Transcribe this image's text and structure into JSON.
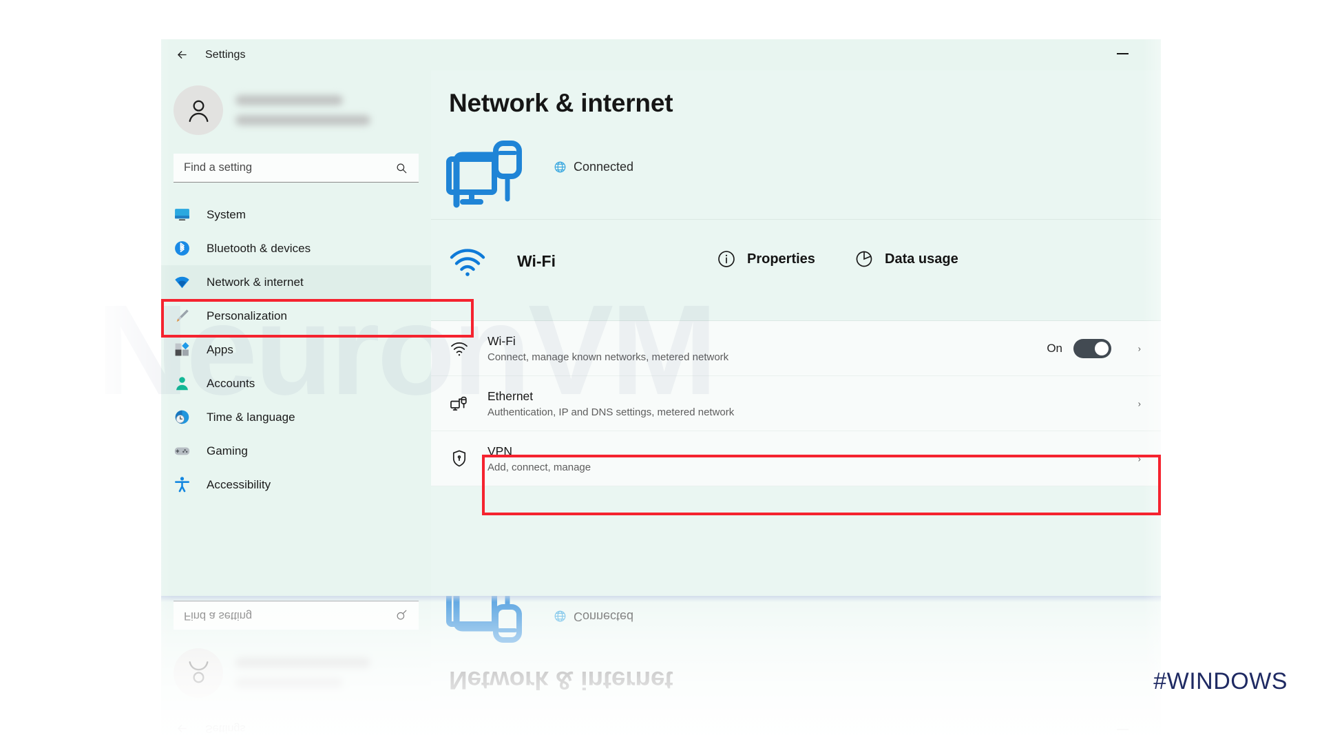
{
  "window": {
    "title": "Settings",
    "back_icon": "back-arrow-icon",
    "minimize_label": "Minimize"
  },
  "sidebar": {
    "account": {
      "avatar_icon": "person-avatar-icon",
      "name_redacted": "",
      "email_redacted": ""
    },
    "search": {
      "placeholder": "Find a setting",
      "icon": "search-icon"
    },
    "items": [
      {
        "label": "System",
        "icon": "monitor-icon",
        "active": false
      },
      {
        "label": "Bluetooth & devices",
        "icon": "bluetooth-icon",
        "active": false
      },
      {
        "label": "Network & internet",
        "icon": "wifi-icon",
        "active": true
      },
      {
        "label": "Personalization",
        "icon": "paintbrush-icon",
        "active": false
      },
      {
        "label": "Apps",
        "icon": "apps-grid-icon",
        "active": false
      },
      {
        "label": "Accounts",
        "icon": "person-icon",
        "active": false
      },
      {
        "label": "Time & language",
        "icon": "clock-globe-icon",
        "active": false
      },
      {
        "label": "Gaming",
        "icon": "gamepad-icon",
        "active": false
      },
      {
        "label": "Accessibility",
        "icon": "accessibility-icon",
        "active": false
      }
    ]
  },
  "content": {
    "page_title": "Network & internet",
    "hero": {
      "icon": "ethernet-connection-icon",
      "status_icon": "globe-icon",
      "status_text": "Connected"
    },
    "quick_actions": [
      {
        "label": "Wi-Fi",
        "icon": "wifi-signal-icon"
      },
      {
        "label": "Properties",
        "icon": "info-circle-icon"
      },
      {
        "label": "Data usage",
        "icon": "pie-chart-icon"
      }
    ],
    "cards": [
      {
        "name": "Wi-Fi",
        "desc": "Connect, manage known networks, metered network",
        "icon": "wifi-small-icon",
        "toggle_label": "On",
        "toggle_on": true,
        "highlighted": false
      },
      {
        "name": "Ethernet",
        "desc": "Authentication, IP and DNS settings, metered network",
        "icon": "ethernet-port-icon",
        "toggle_label": "",
        "toggle_on": false,
        "highlighted": true
      },
      {
        "name": "VPN",
        "desc": "Add, connect, manage",
        "icon": "shield-vpn-icon",
        "toggle_label": "",
        "toggle_on": false,
        "highlighted": false
      }
    ]
  },
  "overlay": {
    "watermark_text": "NeuronVM",
    "hashtag": "#WINDOWS",
    "highlight_color": "#f5232f",
    "hashtag_color": "#1f2a63",
    "accent_color": "#0f7ad4"
  }
}
